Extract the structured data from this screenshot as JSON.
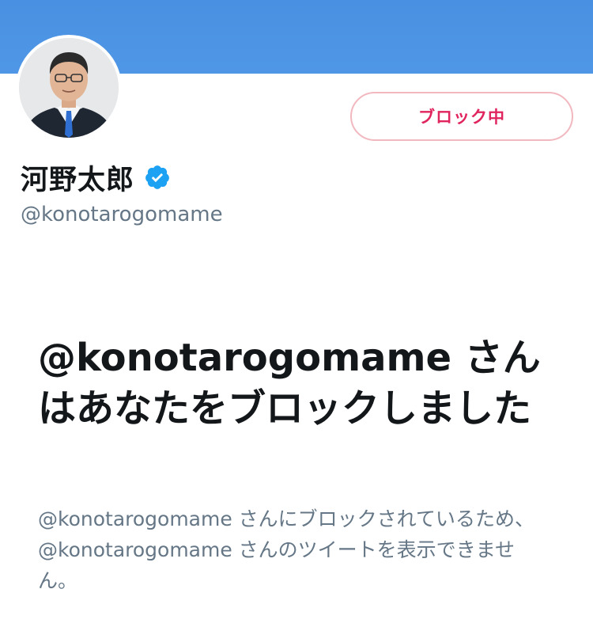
{
  "profile": {
    "display_name": "河野太郎",
    "handle": "@konotarogomame",
    "verified": true,
    "avatar_icon": "profile-photo"
  },
  "actions": {
    "block_button_label": "ブロック中"
  },
  "blocked_notice": {
    "headline": "@konotarogomame さんはあなたをブロックしました",
    "body": "@konotarogomame さんにブロックされているため、@konotarogomame さんのツイートを表示できません。"
  },
  "colors": {
    "banner": "#4a90e2",
    "block_text": "#e0245e",
    "block_border": "#f2b8bf",
    "verified": "#1da1f2",
    "primary_text": "#14171a",
    "secondary_text": "#657786"
  }
}
